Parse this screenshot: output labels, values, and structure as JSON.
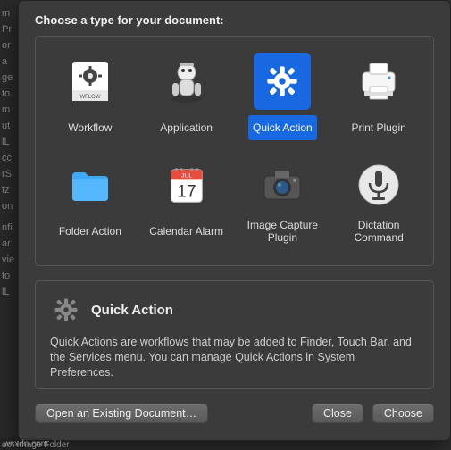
{
  "prompt": "Choose a type for your document:",
  "types": [
    {
      "id": "workflow",
      "label": "Workflow"
    },
    {
      "id": "application",
      "label": "Application"
    },
    {
      "id": "quick-action",
      "label": "Quick Action",
      "selected": true
    },
    {
      "id": "print-plugin",
      "label": "Print Plugin"
    },
    {
      "id": "folder-action",
      "label": "Folder Action"
    },
    {
      "id": "calendar-alarm",
      "label": "Calendar Alarm",
      "calendar_day": "17",
      "calendar_month": "JUL"
    },
    {
      "id": "image-capture-plugin",
      "label": "Image Capture Plugin"
    },
    {
      "id": "dictation-command",
      "label": "Dictation Command"
    }
  ],
  "description": {
    "title": "Quick Action",
    "body": "Quick Actions are workflows that may be added to Finder, Touch Bar, and the Services menu. You can manage Quick Actions in System Preferences."
  },
  "buttons": {
    "open_existing": "Open an Existing Document…",
    "close": "Close",
    "choose": "Choose"
  },
  "watermark": "wsxdn.com",
  "bg_footer": "oot Image Folder"
}
